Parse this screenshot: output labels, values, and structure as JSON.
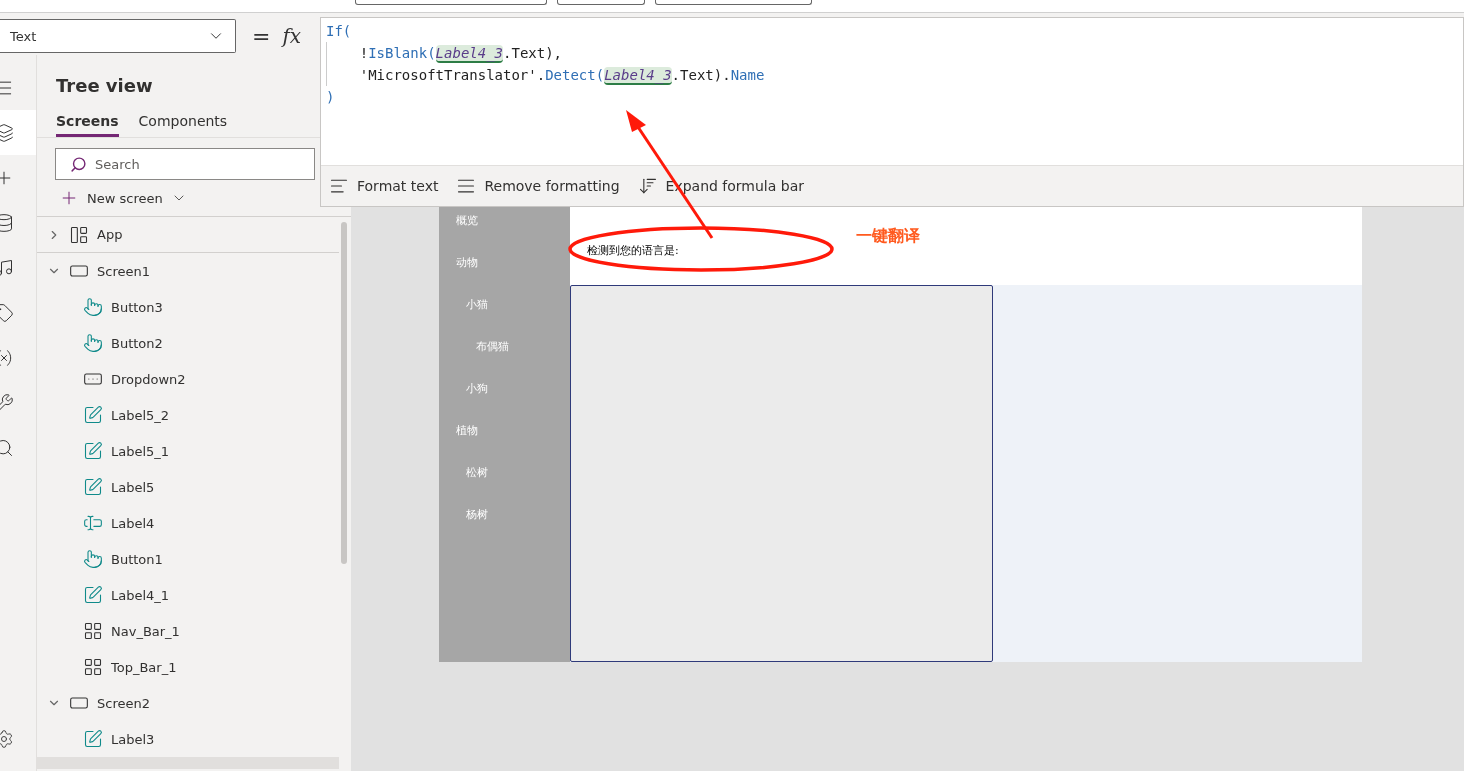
{
  "property_select": {
    "value": "Text"
  },
  "formula": {
    "equals": "=",
    "fx": "fx",
    "lines": [
      {
        "tokens": [
          {
            "kind": "function",
            "text": "If("
          }
        ]
      },
      {
        "tokens": [
          {
            "kind": "plain",
            "text": "    !"
          },
          {
            "kind": "function",
            "text": "IsBlank("
          },
          {
            "kind": "reference",
            "text": "Label4_3"
          },
          {
            "kind": "plain",
            "text": ".Text),"
          }
        ]
      },
      {
        "tokens": [
          {
            "kind": "plain",
            "text": "    'MicrosoftTranslator'."
          },
          {
            "kind": "function",
            "text": "Detect("
          },
          {
            "kind": "reference",
            "text": "Label4_3"
          },
          {
            "kind": "plain",
            "text": ".Text)."
          },
          {
            "kind": "function",
            "text": "Name"
          }
        ]
      },
      {
        "tokens": [
          {
            "kind": "function",
            "text": ")"
          }
        ]
      }
    ],
    "toolbar": [
      {
        "kind": "format",
        "label": "Format text"
      },
      {
        "kind": "remove",
        "label": "Remove formatting"
      },
      {
        "kind": "expand",
        "label": "Expand formula bar"
      }
    ]
  },
  "rail": [
    {
      "kind": "menu",
      "selected": false
    },
    {
      "kind": "layers",
      "selected": true
    },
    {
      "kind": "insert",
      "selected": false
    },
    {
      "kind": "data",
      "selected": false
    },
    {
      "kind": "media",
      "selected": false
    },
    {
      "kind": "tag",
      "selected": false
    },
    {
      "kind": "variables",
      "selected": false
    },
    {
      "kind": "tools",
      "selected": false
    },
    {
      "kind": "search",
      "selected": false
    }
  ],
  "tree_view": {
    "title": "Tree view",
    "tabs": [
      {
        "label": "Screens",
        "selected": true
      },
      {
        "label": "Components",
        "selected": false
      }
    ],
    "search": {
      "placeholder": "Search"
    },
    "new_screen": "New screen",
    "items": [
      {
        "kind": "app",
        "label": "App",
        "expanded": false
      },
      {
        "kind": "screen",
        "label": "Screen1",
        "expanded": true,
        "children": [
          {
            "kind": "button",
            "label": "Button3"
          },
          {
            "kind": "button",
            "label": "Button2"
          },
          {
            "kind": "dropdown",
            "label": "Dropdown2"
          },
          {
            "kind": "label",
            "label": "Label5_2"
          },
          {
            "kind": "label",
            "label": "Label5_1"
          },
          {
            "kind": "label",
            "label": "Label5"
          },
          {
            "kind": "input",
            "label": "Label4"
          },
          {
            "kind": "button",
            "label": "Button1"
          },
          {
            "kind": "label",
            "label": "Label4_1"
          },
          {
            "kind": "group",
            "label": "Nav_Bar_1"
          },
          {
            "kind": "group",
            "label": "Top_Bar_1"
          }
        ]
      },
      {
        "kind": "screen",
        "label": "Screen2",
        "expanded": true,
        "children": [
          {
            "kind": "label",
            "label": "Label3"
          }
        ]
      }
    ]
  },
  "app_canvas": {
    "nav": [
      {
        "label": "概览"
      },
      {
        "label": "动物",
        "children": [
          {
            "label": "小猫",
            "children": [
              {
                "label": "布偶猫"
              }
            ]
          },
          {
            "label": "小狗"
          }
        ]
      },
      {
        "label": "植物",
        "children": [
          {
            "label": "松树"
          },
          {
            "label": "杨树"
          }
        ]
      }
    ],
    "detected_label": "检测到您的语言是:"
  },
  "annotation": {
    "text": "一键翻译"
  }
}
